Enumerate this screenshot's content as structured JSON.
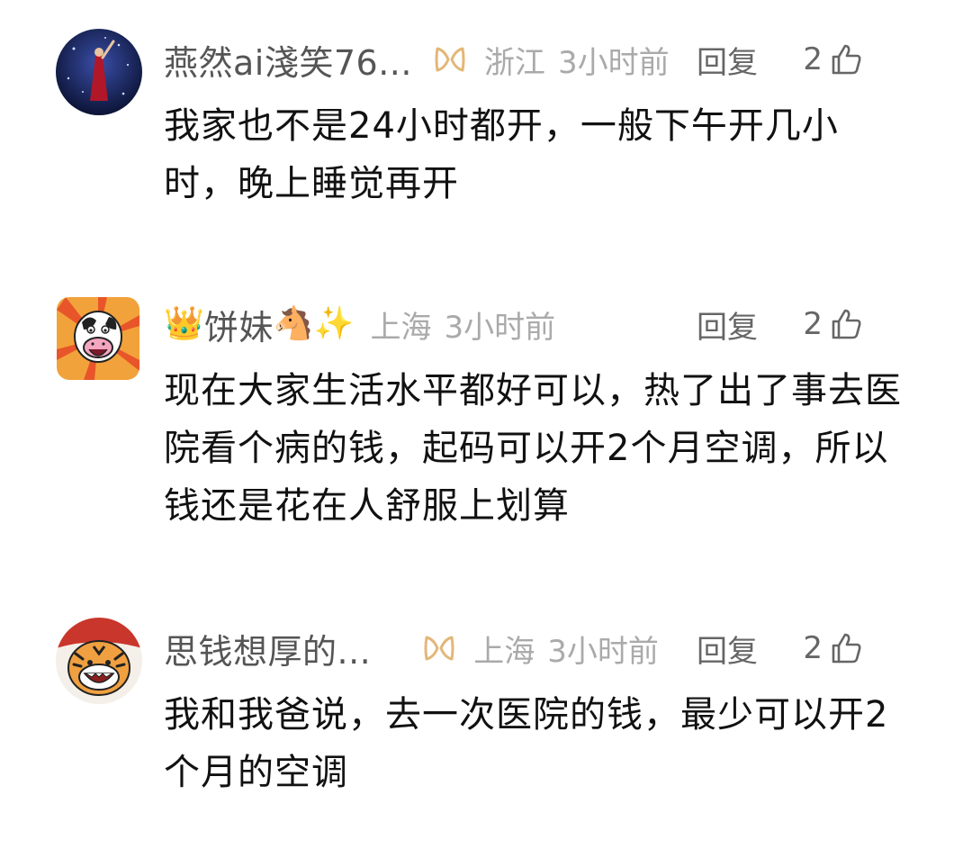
{
  "comments": [
    {
      "username": "燕然ai淺笑76...",
      "location": "浙江",
      "time": "3小时前",
      "reply_label": "回复",
      "likes": "2",
      "text": "我家也不是24小时都开，一般下午开几小时，晚上睡觉再开",
      "avatar_icon": "user-avatar-stage",
      "badge_icon": "member-badge-icon"
    },
    {
      "username_prefix_emoji": "👑",
      "username": "饼妹",
      "username_suffix_emoji": "🐴✨",
      "location": "上海",
      "time": "3小时前",
      "reply_label": "回复",
      "likes": "2",
      "text": "现在大家生活水平都好可以，热了出了事去医院看个病的钱，起码可以开2个月空调，所以钱还是花在人舒服上划算",
      "avatar_icon": "cow-cartoon-avatar"
    },
    {
      "username": "思钱想厚的...",
      "location": "上海",
      "time": "3小时前",
      "reply_label": "回复",
      "likes": "2",
      "text": "我和我爸说，去一次医院的钱，最少可以开2个月的空调",
      "avatar_icon": "tiger-cartoon-avatar",
      "badge_icon": "member-badge-icon"
    }
  ],
  "colors": {
    "username": "#555555",
    "meta": "#aaaaaa",
    "text": "#111111",
    "badge": "#e3b778"
  }
}
